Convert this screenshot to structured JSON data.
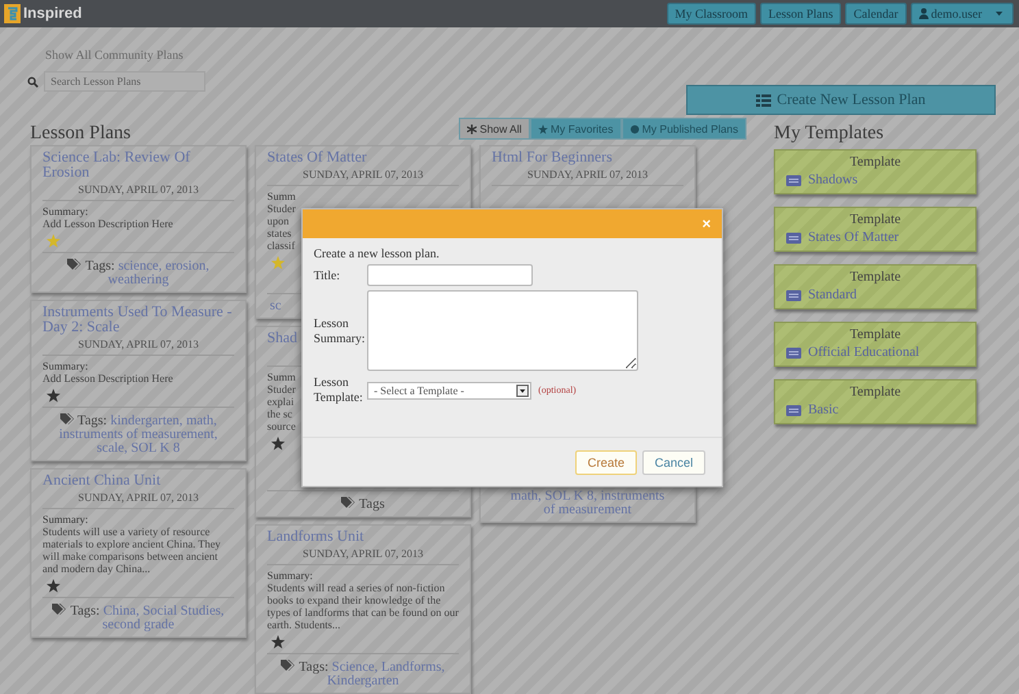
{
  "navbar": {
    "brand": "Inspired",
    "links": [
      {
        "label": "My Classroom"
      },
      {
        "label": "Lesson Plans"
      },
      {
        "label": "Calendar"
      }
    ],
    "user": "demo.user"
  },
  "toolbar": {
    "community_toggle": "Show All Community Plans",
    "search": {
      "placeholder": "Search Lesson Plans"
    },
    "create_button": "Create New Lesson Plan"
  },
  "lesson_plans": {
    "heading": "Lesson Plans",
    "filters": [
      {
        "label": "Show All",
        "kind": "all",
        "selected": true
      },
      {
        "label": "My Favorites",
        "kind": "favorites",
        "selected": false
      },
      {
        "label": "My Published Plans",
        "kind": "published",
        "selected": false
      }
    ],
    "columns": [
      [
        {
          "title": "Science Lab: Review Of Erosion",
          "date": "SUNDAY, APRIL 07, 2013",
          "summary_label": "Summary:",
          "summary": [
            "Add Lesson Description Here"
          ],
          "favorite": true,
          "tags_label": "Tags:",
          "tags": [
            "science,",
            "erosion,",
            "weathering"
          ]
        },
        {
          "title": "Instruments Used To Measure - Day 2: Scale",
          "date": "SUNDAY, APRIL 07, 2013",
          "summary_label": "Summary:",
          "summary": [
            "Add Lesson Description Here"
          ],
          "favorite": false,
          "tags_label": "Tags:",
          "tags": [
            "kindergarten,",
            "math,",
            "instruments of measurement,",
            "scale,",
            "SOL K 8"
          ]
        },
        {
          "title": "Ancient China Unit",
          "date": "SUNDAY, APRIL 07, 2013",
          "summary_label": "Summary:",
          "summary": [
            "Students will use a variety of resource materials to explore ancient China. They will make comparisons between ancient and modern day China..."
          ],
          "favorite": false,
          "tags_label": "Tags:",
          "tags": [
            "China,",
            "Social Studies,",
            "second grade"
          ]
        }
      ],
      [
        {
          "kind": "upper",
          "title": "States Of Matter",
          "date": "SUNDAY, APRIL 07, 2013",
          "summary_label": "Summ",
          "summary": [
            "Studer",
            "upon",
            "states",
            "classif"
          ],
          "favorite": true,
          "tags": [
            "sc"
          ]
        },
        {
          "kind": "lower",
          "title": "Shad",
          "summary_label": "Summ",
          "summary": [
            "Studer",
            "explai",
            "the sc",
            "source"
          ],
          "favorite": false,
          "tags_label": "Tags"
        },
        {
          "title": "Landforms Unit",
          "date": "SUNDAY, APRIL 07, 2013",
          "summary_label": "Summary:",
          "summary": [
            "Students will read a series of non-fiction books to expand their knowledge of the types of landforms that can be found on our earth. Students..."
          ],
          "favorite": false,
          "tags_label": "Tags:",
          "tags": [
            "Science,",
            "Landforms,",
            "Kindergarten"
          ]
        }
      ],
      [
        {
          "kind": "middle",
          "title": "Html For Beginners",
          "date": "SUNDAY, APRIL 07, 2013",
          "tags": [
            "math,",
            "SOL K 8,",
            "instruments",
            "of measurement"
          ]
        }
      ]
    ]
  },
  "templates": {
    "heading": "My Templates",
    "items": [
      {
        "label": "Template",
        "name": "Shadows"
      },
      {
        "label": "Template",
        "name": "States Of Matter"
      },
      {
        "label": "Template",
        "name": "Standard"
      },
      {
        "label": "Template",
        "name": "Official Educational"
      },
      {
        "label": "Template",
        "name": "Basic"
      }
    ]
  },
  "dialog": {
    "close": "×",
    "intro": "Create a new lesson plan.",
    "fields": [
      {
        "kind": "input",
        "label": "Title:"
      },
      {
        "kind": "textarea",
        "label": "Lesson Summary:"
      },
      {
        "kind": "select",
        "label": "Lesson Template:",
        "value": "- Select a Template -",
        "note": "(optional)"
      }
    ],
    "buttons": [
      {
        "label": "Create",
        "kind": "primary"
      },
      {
        "label": "Cancel",
        "kind": "secondary"
      }
    ]
  }
}
